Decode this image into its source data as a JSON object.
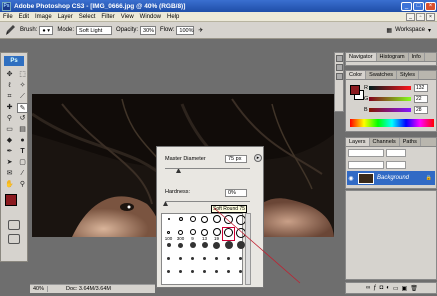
{
  "window": {
    "title": "Adobe Photoshop CS3 - [IMG_0666.jpg @ 40% (RGB/8)]",
    "app_icon": "Ps"
  },
  "menu": [
    "File",
    "Edit",
    "Image",
    "Layer",
    "Select",
    "Filter",
    "View",
    "Window",
    "Help"
  ],
  "options": {
    "brush_label": "Brush:",
    "mode_label": "Mode:",
    "mode_value": "Soft Light",
    "opacity_label": "Opacity:",
    "opacity_value": "30%",
    "flow_label": "Flow:",
    "flow_value": "100%",
    "workspace_label": "Workspace"
  },
  "toolbox": {
    "logo": "Ps"
  },
  "brush_picker": {
    "diameter_label": "Master Diameter",
    "diameter_value": "75 px",
    "hardness_label": "Hardness:",
    "hardness_value": "0%",
    "diameter_fraction": 0.15,
    "hardness_fraction": 0.0,
    "brushes": [
      {
        "num": "",
        "size": 2
      },
      {
        "num": "",
        "size": 4
      },
      {
        "num": "",
        "size": 6
      },
      {
        "num": "",
        "size": 7
      },
      {
        "num": "",
        "size": 8
      },
      {
        "num": "",
        "size": 9
      },
      {
        "num": "",
        "size": 10
      },
      {
        "num": "100",
        "size": 3
      },
      {
        "num": "300",
        "size": 5
      },
      {
        "num": "9",
        "size": 6
      },
      {
        "num": "13",
        "size": 7
      },
      {
        "num": "19",
        "size": 8
      },
      {
        "num": "",
        "size": 9
      },
      {
        "num": "",
        "size": 10
      },
      {
        "num": "",
        "size": 4
      },
      {
        "num": "",
        "size": 5
      },
      {
        "num": "",
        "size": 6
      },
      {
        "num": "",
        "size": 6
      },
      {
        "num": "",
        "size": 7
      },
      {
        "num": "",
        "size": 8
      },
      {
        "num": "",
        "size": 8
      },
      {
        "num": "",
        "size": 3
      },
      {
        "num": "",
        "size": 3
      },
      {
        "num": "",
        "size": 3
      },
      {
        "num": "",
        "size": 3
      },
      {
        "num": "",
        "size": 3
      },
      {
        "num": "",
        "size": 3
      },
      {
        "num": "",
        "size": 3
      },
      {
        "num": "",
        "size": 3
      },
      {
        "num": "",
        "size": 3
      },
      {
        "num": "",
        "size": 3
      },
      {
        "num": "",
        "size": 3
      },
      {
        "num": "",
        "size": 3
      },
      {
        "num": "",
        "size": 3
      },
      {
        "num": "",
        "size": 3
      }
    ],
    "tooltip": "Soft Round 75"
  },
  "panels": {
    "navigator_tabs": [
      "Navigator",
      "Histogram",
      "Info"
    ],
    "color_tabs": [
      "Color",
      "Swatches",
      "Styles"
    ],
    "color": {
      "r": "132",
      "g": "22",
      "b": "28"
    },
    "layers_tabs": [
      "Layers",
      "Channels",
      "Paths"
    ],
    "layer_name": "Background"
  },
  "status": {
    "zoom": "40%",
    "doc": "Doc: 3.64M/3.64M"
  }
}
